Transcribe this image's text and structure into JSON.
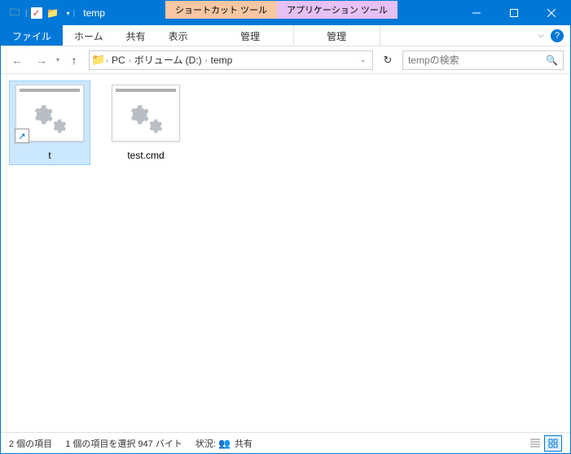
{
  "title": "temp",
  "tooltabs": {
    "shortcut": "ショートカット ツール",
    "app": "アプリケーション ツール"
  },
  "ribbon": {
    "file": "ファイル",
    "home": "ホーム",
    "share": "共有",
    "view": "表示",
    "manage1": "管理",
    "manage2": "管理"
  },
  "breadcrumbs": {
    "pc": "PC",
    "vol": "ボリューム (D:)",
    "folder": "temp"
  },
  "search": {
    "placeholder": "tempの検索"
  },
  "files": {
    "item0": {
      "name": "t"
    },
    "item1": {
      "name": "test.cmd"
    }
  },
  "status": {
    "count": "2 個の項目",
    "selection": "1 個の項目を選択 947 バイト",
    "state_label": "状況:",
    "state_value": "共有"
  }
}
